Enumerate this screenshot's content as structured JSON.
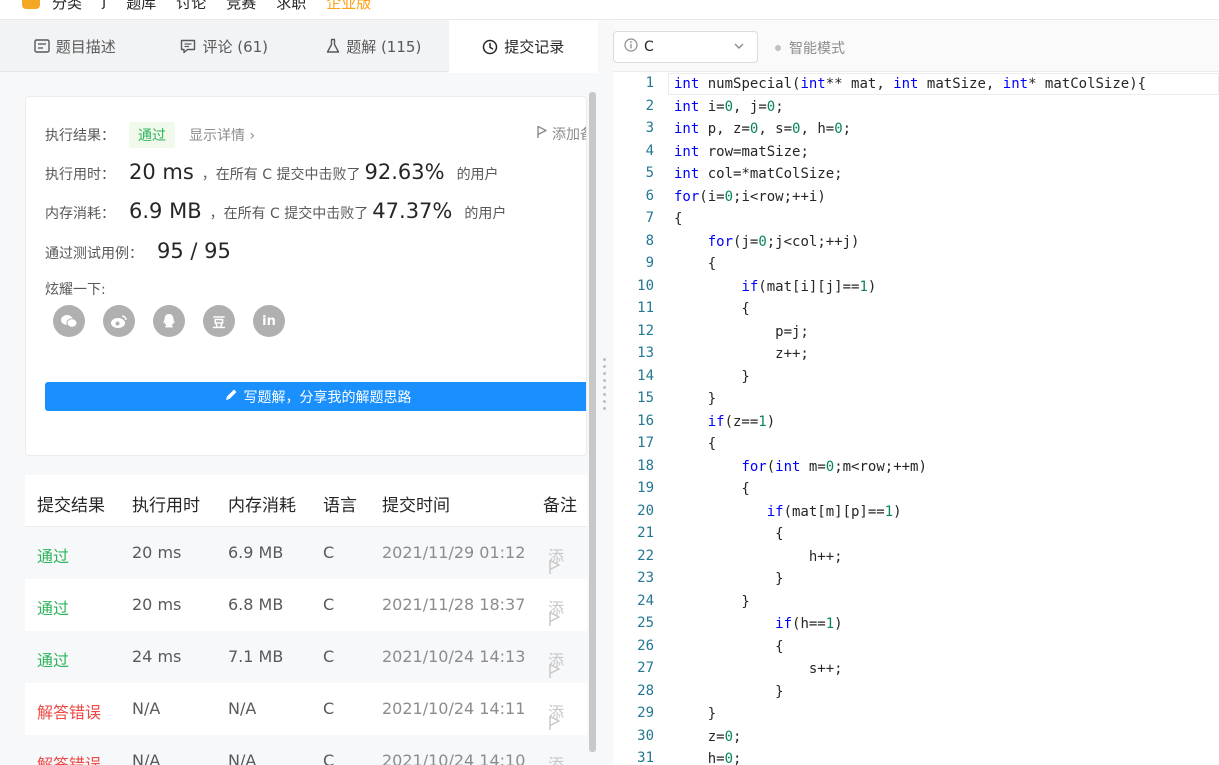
{
  "topbar": {
    "nav": [
      "分类",
      "j",
      "题库",
      "讨论",
      "竞赛",
      "求职",
      "企业版"
    ]
  },
  "tabs": [
    {
      "label": "题目描述",
      "icon": "document-icon"
    },
    {
      "label": "评论 (61)",
      "icon": "comment-icon"
    },
    {
      "label": "题解 (115)",
      "icon": "flask-icon"
    },
    {
      "label": "提交记录",
      "icon": "clock-icon"
    }
  ],
  "result": {
    "status_label": "执行结果：",
    "status_value": "通过",
    "detail_link": "显示详情 ›",
    "add_note": "添加备注",
    "time_label": "执行用时：",
    "time_value": "20 ms",
    "time_mid": "，在所有 C 提交中击败了",
    "time_pct": "92.63%",
    "time_suffix": "的用户",
    "mem_label": "内存消耗：",
    "mem_value": "6.9 MB",
    "mem_mid": "，在所有 C 提交中击败了",
    "mem_pct": "47.37%",
    "mem_suffix": "的用户",
    "tests_label": "通过测试用例：",
    "tests_value": "95 / 95",
    "share_label": "炫耀一下:",
    "share_icons": [
      "wechat-icon",
      "weibo-icon",
      "qq-icon",
      "douban-icon",
      "linkedin-icon"
    ],
    "share_glyphs": [
      "",
      "",
      "",
      "豆",
      "in"
    ],
    "write_button": "写题解，分享我的解题思路"
  },
  "submissions": {
    "headers": [
      "提交结果",
      "执行用时",
      "内存消耗",
      "语言",
      "提交时间",
      "备注"
    ],
    "rows": [
      {
        "result": "通过",
        "ok": true,
        "time": "20 ms",
        "mem": "6.9 MB",
        "lang": "C",
        "date": "2021/11/29 01:12",
        "note": "添"
      },
      {
        "result": "通过",
        "ok": true,
        "time": "20 ms",
        "mem": "6.8 MB",
        "lang": "C",
        "date": "2021/11/28 18:37",
        "note": "添"
      },
      {
        "result": "通过",
        "ok": true,
        "time": "24 ms",
        "mem": "7.1 MB",
        "lang": "C",
        "date": "2021/10/24 14:13",
        "note": "添"
      },
      {
        "result": "解答错误",
        "ok": false,
        "time": "N/A",
        "mem": "N/A",
        "lang": "C",
        "date": "2021/10/24 14:11",
        "note": "添"
      },
      {
        "result": "解答错误",
        "ok": false,
        "time": "N/A",
        "mem": "N/A",
        "lang": "C",
        "date": "2021/10/24 14:10",
        "note": "添"
      }
    ]
  },
  "editor": {
    "language": "C",
    "smart_mode": "智能模式",
    "lines": [
      "int numSpecial(int** mat, int matSize, int* matColSize){",
      "int i=0, j=0;",
      "int p, z=0, s=0, h=0;",
      "int row=matSize;",
      "int col=*matColSize;",
      "for(i=0;i<row;++i)",
      "{",
      "    for(j=0;j<col;++j)",
      "    {",
      "        if(mat[i][j]==1)",
      "        {",
      "            p=j;",
      "            z++;",
      "        }",
      "    }",
      "    if(z==1)",
      "    {",
      "        for(int m=0;m<row;++m)",
      "        {",
      "           if(mat[m][p]==1)",
      "            {",
      "                h++;",
      "            }",
      "        }",
      "            if(h==1)",
      "            {",
      "                s++;",
      "            }",
      "    }",
      "    z=0;",
      "    h=0;"
    ]
  },
  "colors": {
    "accent": "#1a90ff",
    "pass": "#2db55d",
    "fail": "#ef4743",
    "keyword": "#0000ff",
    "number": "#098658",
    "line_number": "#237893"
  }
}
